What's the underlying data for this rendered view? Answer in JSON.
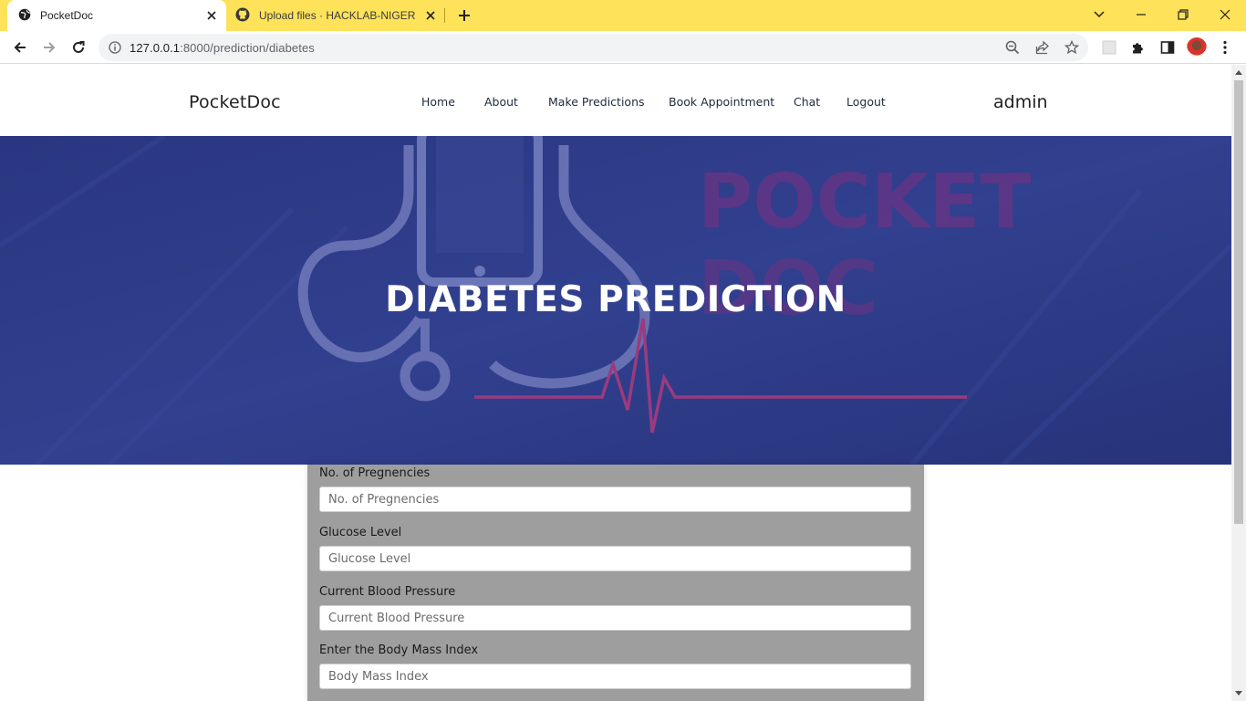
{
  "browser": {
    "tabs": [
      {
        "title": "PocketDoc",
        "active": true
      },
      {
        "title": "Upload files · HACKLAB-NIGERIA",
        "active": false
      }
    ],
    "url_host": "127.0.0.1",
    "url_path": ":8000/prediction/diabetes"
  },
  "site": {
    "brand": "PocketDoc",
    "nav": [
      "Home",
      "About",
      "Make Predictions",
      "Book Appointment",
      "Chat",
      "Logout"
    ],
    "user": "admin"
  },
  "hero": {
    "title": "DIABETES PREDICTION",
    "background_words": [
      "POCKET",
      "DOC"
    ]
  },
  "form": {
    "fields": [
      {
        "label": "No. of Pregnencies",
        "placeholder": "No. of Pregnencies"
      },
      {
        "label": "Glucose Level",
        "placeholder": "Glucose Level"
      },
      {
        "label": "Current Blood Pressure",
        "placeholder": "Current Blood Pressure"
      },
      {
        "label": "Enter the Body Mass Index",
        "placeholder": "Body Mass Index"
      }
    ]
  },
  "colors": {
    "tab_strip": "#fde25a",
    "hero_overlay": "#2d3a86",
    "form_card": "#9e9e9e"
  }
}
